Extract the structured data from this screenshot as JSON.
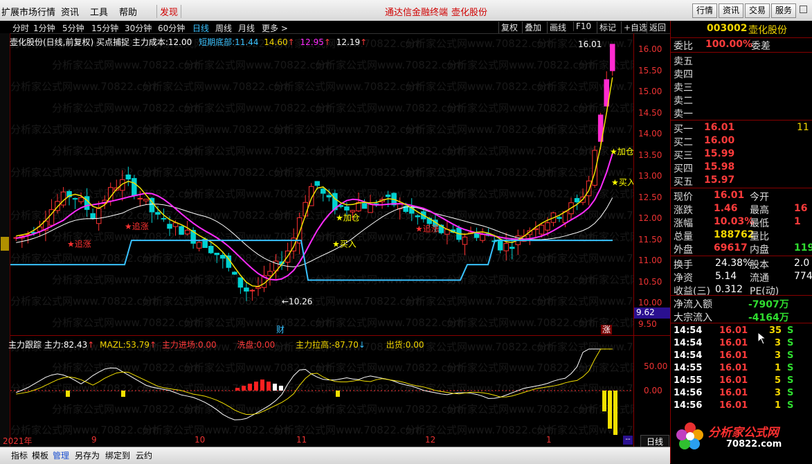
{
  "menu": {
    "items": [
      "扩展市场行情",
      "资讯",
      "工具",
      "帮助"
    ],
    "discover": "发现",
    "center_left": "通达信金融终端",
    "center_right": "壶化股份",
    "right_buttons": [
      "行情",
      "资讯",
      "交易",
      "服务"
    ]
  },
  "periods": {
    "items": [
      "分时",
      "1分钟",
      "5分钟",
      "15分钟",
      "30分钟",
      "60分钟",
      "日线",
      "周线",
      "月线",
      "更多 >"
    ],
    "active": "日线",
    "tools": [
      "复权",
      "叠加",
      "画线",
      "F10",
      "标记",
      "+自选",
      "返回"
    ]
  },
  "info": {
    "title": "壶化股份(日线,前复权) 买点捕捉",
    "cost_label": "主力成本:",
    "cost_val": "12.00",
    "support_label": "短期底部:",
    "support_vals": [
      "11.44",
      "14.60",
      "12.95",
      "12.19"
    ]
  },
  "indicator": {
    "name": "主力跟踪",
    "zhuli_label": "主力:",
    "zhuli_val": "82.43",
    "mazl_label": "MAZL:",
    "mazl_val": "53.79",
    "jinchang_label": "主力进场:",
    "jinchang_val": "0.00",
    "xipan_label": "洗盘:",
    "xipan_val": "0.00",
    "lagao_label": "主力拉高:",
    "lagao_val": "-87.70",
    "chuhuo_label": "出货:",
    "chuhuo_val": "0.00"
  },
  "chart_data": {
    "type": "candlestick",
    "price_axis": [
      "16.00",
      "15.50",
      "15.00",
      "14.50",
      "14.00",
      "13.50",
      "13.00",
      "12.50",
      "12.00",
      "11.50",
      "11.00",
      "10.50",
      "10.00",
      "9.50"
    ],
    "ylim": [
      9.4,
      16.25
    ],
    "current_box": "9.62",
    "ind_axis": [
      "50.00",
      "0.00"
    ],
    "high_label": "16.01",
    "low_label": "10.26",
    "annotations": [
      "追涨",
      "追涨",
      "加仓",
      "买入",
      "追涨",
      "加仓",
      "买入"
    ],
    "markers": [
      "财",
      "涨"
    ],
    "dates": [
      "2021年",
      "9",
      "10",
      "11",
      "12",
      "1"
    ],
    "bottom_right_label": "日线"
  },
  "quote": {
    "code": "003002",
    "name": "壶化股份",
    "weibi_label": "委比",
    "weibi": "100.00%",
    "weicha_label": "委差",
    "sells": [
      "卖五",
      "卖四",
      "卖三",
      "卖二",
      "卖一"
    ],
    "buys": [
      {
        "label": "买一",
        "price": "16.01",
        "vol": "11"
      },
      {
        "label": "买二",
        "price": "16.00",
        "vol": ""
      },
      {
        "label": "买三",
        "price": "15.99",
        "vol": ""
      },
      {
        "label": "买四",
        "price": "15.98",
        "vol": ""
      },
      {
        "label": "买五",
        "price": "15.97",
        "vol": ""
      }
    ],
    "stats": [
      {
        "l1": "现价",
        "v1": "16.01",
        "l2": "今开",
        "v2": ""
      },
      {
        "l1": "涨跌",
        "v1": "1.46",
        "l2": "最高",
        "v2": "16"
      },
      {
        "l1": "涨幅",
        "v1": "10.03%",
        "l2": "最低",
        "v2": "1"
      },
      {
        "l1": "总量",
        "v1": "188762",
        "l2": "量比",
        "v2": ""
      },
      {
        "l1": "外盘",
        "v1": "69617",
        "l2": "内盘",
        "v2": "119"
      }
    ],
    "stats2": [
      {
        "l1": "换手",
        "v1": "24.38%",
        "l2": "股本",
        "v2": "2.0"
      },
      {
        "l1": "净资",
        "v1": "5.14",
        "l2": "流通",
        "v2": "774"
      },
      {
        "l1": "收益(三)",
        "v1": "0.312",
        "l2": "PE(动)",
        "v2": ""
      }
    ],
    "flows": [
      {
        "label": "净流入额",
        "val": "-7907万"
      },
      {
        "label": "大宗流入",
        "val": "-4164万"
      }
    ],
    "ticks": [
      {
        "t": "14:54",
        "p": "16.01",
        "v": "35",
        "d": "S"
      },
      {
        "t": "14:54",
        "p": "16.01",
        "v": "3",
        "d": "S"
      },
      {
        "t": "14:54",
        "p": "16.01",
        "v": "3",
        "d": "S"
      },
      {
        "t": "14:55",
        "p": "16.01",
        "v": "1",
        "d": "S"
      },
      {
        "t": "14:55",
        "p": "16.01",
        "v": "5",
        "d": "S"
      },
      {
        "t": "14:56",
        "p": "16.01",
        "v": "3",
        "d": "S"
      },
      {
        "t": "14:56",
        "p": "16.01",
        "v": "1",
        "d": "S"
      }
    ],
    "logo_text": "分析家公式网",
    "logo_url": "70822.com"
  },
  "bottom": {
    "items": [
      "指标",
      "模板",
      "管理",
      "另存为",
      "绑定到",
      "云约"
    ]
  }
}
